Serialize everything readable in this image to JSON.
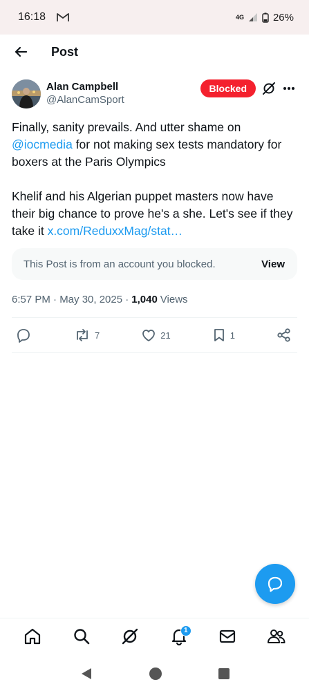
{
  "status_bar": {
    "time": "16:18",
    "network": "4G",
    "battery": "26%"
  },
  "header": {
    "title": "Post"
  },
  "post": {
    "author_name": "Alan Campbell",
    "author_handle": "@AlanCamSport",
    "blocked_label": "Blocked",
    "text_1a": "Finally, sanity prevails. And utter shame on",
    "mention": "@iocmedia",
    "text_1b": "  for not making sex tests mandatory for boxers at the Paris Olympics",
    "text_2": "Khelif and his Algerian puppet masters now have their big chance to prove he's a she. Let's see if they take it ",
    "link": "x.com/ReduxxMag/stat…",
    "notice_text": "This Post is from an account you blocked.",
    "notice_action": "View",
    "timestamp": "6:57 PM · May 30, 2025 · ",
    "views_count": "1,040",
    "views_label": " Views",
    "reposts": "7",
    "likes": "21",
    "bookmarks": "1"
  },
  "bottom_nav": {
    "notification_badge": "1"
  },
  "colors": {
    "accent": "#1d9bf0",
    "blocked": "#f4212e",
    "muted": "#536471"
  },
  "icons": [
    "back-arrow-icon",
    "grok-icon",
    "more-icon",
    "reply-icon",
    "repost-icon",
    "like-icon",
    "bookmark-icon",
    "share-icon",
    "compose-message-icon",
    "home-icon",
    "search-icon",
    "notifications-icon",
    "messages-icon",
    "communities-icon"
  ]
}
